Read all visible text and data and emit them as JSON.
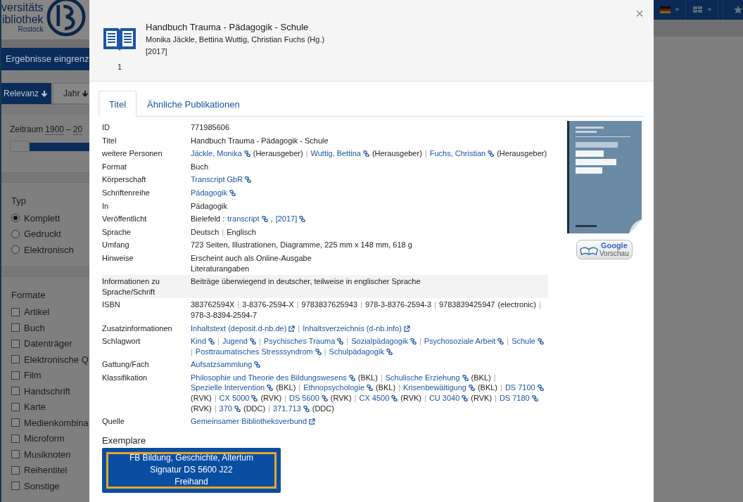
{
  "sidebar": {
    "logo_lines": [
      "versitäts",
      "ibliothek",
      "Rostock"
    ],
    "filter_bar": "Ergebnisse eingrenz",
    "sort_tabs": [
      {
        "label": "Relevanz",
        "selected": true
      },
      {
        "label": "Jahr",
        "selected": false
      }
    ],
    "period": {
      "label": "Zeitraum",
      "from": "1900",
      "dash": "–",
      "to": "20",
      "level": 0
    },
    "type_filter": {
      "heading": "Typ",
      "options": [
        {
          "label": "Komplett",
          "selected": true
        },
        {
          "label": "Gedruckt",
          "selected": false
        },
        {
          "label": "Elektronisch",
          "selected": false
        }
      ]
    },
    "formats": {
      "heading": "Formate",
      "options": [
        {
          "label": "Artikel",
          "checked": false
        },
        {
          "label": "Buch",
          "checked": false
        },
        {
          "label": "Datenträger",
          "checked": false
        },
        {
          "label": "Elektronische Q",
          "checked": false
        },
        {
          "label": "Film",
          "checked": false
        },
        {
          "label": "Handschrift",
          "checked": false
        },
        {
          "label": "Karte",
          "checked": false
        },
        {
          "label": "Medienkombina",
          "checked": false
        },
        {
          "label": "Microform",
          "checked": false
        },
        {
          "label": "Musiknoten",
          "checked": false
        },
        {
          "label": "Reihentitel",
          "checked": false
        },
        {
          "label": "Sonstige",
          "checked": false
        }
      ]
    }
  },
  "record": {
    "count": "1",
    "title": "Handbuch Trauma - Pädagogik - Schule",
    "authors": "Monika Jäckle, Bettina Wuttig, Christian Fuchs (Hg.)",
    "year": "[2017]",
    "close": "×"
  },
  "tabs": [
    {
      "label": "Titel",
      "selected": true
    },
    {
      "label": "Ähnliche Publikationen",
      "selected": false
    }
  ],
  "details": [
    {
      "label": "ID",
      "highlighted": false,
      "lines": [
        [
          {
            "kind": "text",
            "text": "771985606"
          }
        ]
      ]
    },
    {
      "label": "Titel",
      "highlighted": false,
      "lines": [
        [
          {
            "kind": "text",
            "text": "Handbuch Trauma - Pädagogik - Schule"
          }
        ]
      ]
    },
    {
      "label": "weitere Personen",
      "highlighted": false,
      "lines": [
        [
          {
            "kind": "link",
            "text": "Jäckle, Monika"
          },
          {
            "kind": "text",
            "text": "(Herausgeber)"
          },
          {
            "kind": "sep",
            "text": "|"
          },
          {
            "kind": "link",
            "text": "Wuttig, Bettina"
          },
          {
            "kind": "text",
            "text": "(Herausgeber)"
          },
          {
            "kind": "sep",
            "text": "|"
          },
          {
            "kind": "link",
            "text": "Fuchs, Christian"
          },
          {
            "kind": "text",
            "text": "(Herausgeber)"
          }
        ]
      ]
    },
    {
      "label": "Format",
      "highlighted": false,
      "lines": [
        [
          {
            "kind": "text",
            "text": "Buch"
          }
        ]
      ]
    },
    {
      "label": "Körperschaft",
      "highlighted": false,
      "lines": [
        [
          {
            "kind": "link",
            "text": "Transcript GbR"
          }
        ]
      ]
    },
    {
      "label": "Schriftenreihe",
      "highlighted": false,
      "lines": [
        [
          {
            "kind": "link",
            "text": "Pädagogik"
          }
        ]
      ]
    },
    {
      "label": "In",
      "highlighted": false,
      "lines": [
        [
          {
            "kind": "text",
            "text": "Pädagogik"
          }
        ]
      ]
    },
    {
      "label": "Veröffentlicht",
      "highlighted": false,
      "lines": [
        [
          {
            "kind": "text",
            "text": "Bielefeld :"
          },
          {
            "kind": "link",
            "text": "transcript"
          },
          {
            "kind": "text",
            "text": ","
          },
          {
            "kind": "link",
            "text": "[2017]"
          }
        ]
      ]
    },
    {
      "label": "Sprache",
      "highlighted": false,
      "lines": [
        [
          {
            "kind": "text",
            "text": "Deutsch"
          },
          {
            "kind": "sep",
            "text": "|"
          },
          {
            "kind": "text",
            "text": "Englisch"
          }
        ]
      ]
    },
    {
      "label": "Umfang",
      "highlighted": false,
      "lines": [
        [
          {
            "kind": "text",
            "text": "723 Seiten, Illustrationen, Diagramme, 225 mm x 148 mm, 618 g"
          }
        ]
      ]
    },
    {
      "label": "Hinweise",
      "highlighted": false,
      "lines": [
        [
          {
            "kind": "text",
            "text": "Erscheint auch als Online-Ausgabe"
          }
        ],
        [
          {
            "kind": "text",
            "text": "Literaturangaben"
          }
        ]
      ]
    },
    {
      "label": "Informationen zu Sprache/Schrift",
      "highlighted": true,
      "lines": [
        [
          {
            "kind": "text",
            "text": "Beiträge überwiegend in deutscher, teilweise in englischer Sprache"
          }
        ]
      ]
    },
    {
      "label": "ISBN",
      "highlighted": false,
      "lines": [
        [
          {
            "kind": "text",
            "text": "383762594X"
          },
          {
            "kind": "sep",
            "text": "|"
          },
          {
            "kind": "text",
            "text": "3-8376-2594-X"
          },
          {
            "kind": "sep",
            "text": "|"
          },
          {
            "kind": "text",
            "text": "9783837625943"
          },
          {
            "kind": "sep",
            "text": "|"
          },
          {
            "kind": "text",
            "text": "978-3-8376-2594-3"
          },
          {
            "kind": "sep",
            "text": "|"
          },
          {
            "kind": "text",
            "text": "9783839425947"
          },
          {
            "kind": "text",
            "text": "(electronic)"
          },
          {
            "kind": "sep",
            "text": "|"
          },
          {
            "kind": "text",
            "text": "978-3-8394-2594-7"
          }
        ]
      ]
    },
    {
      "label": "Zusatzinformationen",
      "highlighted": false,
      "lines": [
        [
          {
            "kind": "ext",
            "text": "Inhaltstext (deposit.d-nb.de)"
          },
          {
            "kind": "sep",
            "text": "|"
          },
          {
            "kind": "ext",
            "text": "Inhaltsverzeichnis (d-nb.info)"
          }
        ]
      ]
    },
    {
      "label": "Schlagwort",
      "highlighted": false,
      "lines": [
        [
          {
            "kind": "link",
            "text": "Kind"
          },
          {
            "kind": "sep",
            "text": "|"
          },
          {
            "kind": "link",
            "text": "Jugend"
          },
          {
            "kind": "sep",
            "text": "|"
          },
          {
            "kind": "link",
            "text": "Psychisches Trauma"
          },
          {
            "kind": "sep",
            "text": "|"
          },
          {
            "kind": "link",
            "text": "Sozialpädagogik"
          },
          {
            "kind": "sep",
            "text": "|"
          },
          {
            "kind": "link",
            "text": "Psychosoziale Arbeit"
          },
          {
            "kind": "sep",
            "text": "|"
          },
          {
            "kind": "link",
            "text": "Schule"
          },
          {
            "kind": "sep",
            "text": "|"
          },
          {
            "kind": "link",
            "text": "Posttraumatisches Stresssyndrom"
          },
          {
            "kind": "sep",
            "text": "|"
          },
          {
            "kind": "link",
            "text": "Schulpädagogik"
          }
        ]
      ]
    },
    {
      "label": "Gattung/Fach",
      "highlighted": false,
      "lines": [
        [
          {
            "kind": "link",
            "text": "Aufsatzsammlung"
          }
        ]
      ]
    },
    {
      "label": "Klassifikation",
      "highlighted": false,
      "lines": [
        [
          {
            "kind": "link",
            "text": "Philosophie und Theorie des Bildungswesens"
          },
          {
            "kind": "text",
            "text": "(BKL)"
          },
          {
            "kind": "sep",
            "text": "|"
          },
          {
            "kind": "link",
            "text": "Schulische Erziehung"
          },
          {
            "kind": "text",
            "text": "(BKL)"
          },
          {
            "kind": "sep",
            "text": "|"
          },
          {
            "kind": "link",
            "text": "Spezielle Intervention"
          },
          {
            "kind": "text",
            "text": "(BKL)"
          },
          {
            "kind": "sep",
            "text": "|"
          },
          {
            "kind": "link",
            "text": "Ethnopsychologie"
          },
          {
            "kind": "text",
            "text": "(BKL)"
          },
          {
            "kind": "sep",
            "text": "|"
          },
          {
            "kind": "link",
            "text": "Krisenbewältigung"
          },
          {
            "kind": "text",
            "text": "(BKL)"
          },
          {
            "kind": "sep",
            "text": "|"
          },
          {
            "kind": "link",
            "text": "DS 7100"
          },
          {
            "kind": "text",
            "text": "(RVK)"
          },
          {
            "kind": "sep",
            "text": "|"
          },
          {
            "kind": "link",
            "text": "CX 5000"
          },
          {
            "kind": "text",
            "text": "(RVK)"
          },
          {
            "kind": "sep",
            "text": "|"
          },
          {
            "kind": "link",
            "text": "DS 5600"
          },
          {
            "kind": "text",
            "text": "(RVK)"
          },
          {
            "kind": "sep",
            "text": "|"
          },
          {
            "kind": "link",
            "text": "CX 4500"
          },
          {
            "kind": "text",
            "text": "(RVK)"
          },
          {
            "kind": "sep",
            "text": "|"
          },
          {
            "kind": "link",
            "text": "CU 3040"
          },
          {
            "kind": "text",
            "text": "(RVK)"
          },
          {
            "kind": "sep",
            "text": "|"
          },
          {
            "kind": "link",
            "text": "DS 7180"
          },
          {
            "kind": "text",
            "text": "(RVK)"
          },
          {
            "kind": "sep",
            "text": "|"
          },
          {
            "kind": "link",
            "text": "370"
          },
          {
            "kind": "text",
            "text": "(DDC)"
          },
          {
            "kind": "sep",
            "text": "|"
          },
          {
            "kind": "link",
            "text": "371.713"
          },
          {
            "kind": "text",
            "text": "(DDC)"
          }
        ]
      ]
    },
    {
      "label": "Quelle",
      "highlighted": false,
      "lines": [
        [
          {
            "kind": "ext",
            "text": "Gemeinsamer Bibliotheksverbund"
          }
        ]
      ]
    }
  ],
  "preview_button": {
    "brand": "Google",
    "label": "Vorschau"
  },
  "holdings": {
    "heading": "Exemplare",
    "lines": [
      "FB Bildung, Geschichte, Altertum",
      "Signatur DS 5600 J22",
      "Freihand"
    ]
  }
}
